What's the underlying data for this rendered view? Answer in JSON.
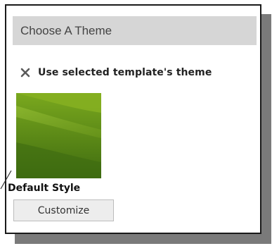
{
  "panel": {
    "title": "Choose A Theme",
    "use_template_theme_label": "Use selected template's theme",
    "use_template_icon": "close-x-icon",
    "theme": {
      "name": "Default Style",
      "customize_label": "Customize",
      "thumbnail_colors": [
        "#4b7a14",
        "#86b021",
        "#9cc43a",
        "#3d6a10"
      ]
    }
  }
}
